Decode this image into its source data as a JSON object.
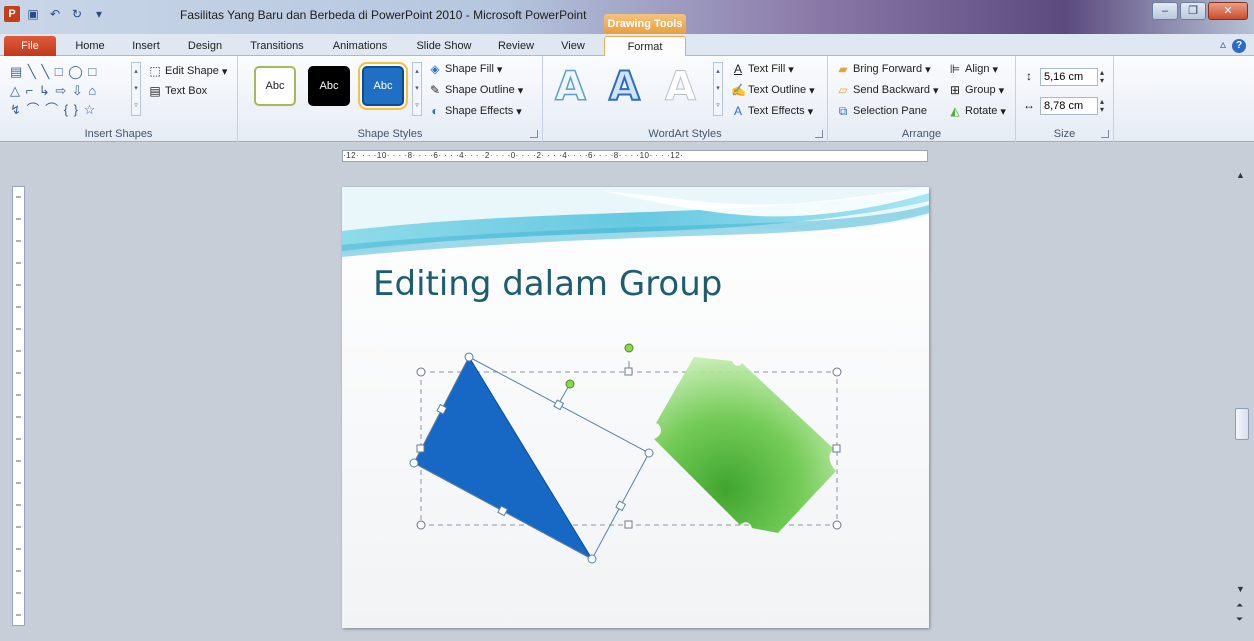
{
  "window": {
    "title": "Fasilitas Yang Baru dan Berbeda di PowerPoint 2010 - Microsoft PowerPoint",
    "contextual_tab_group": "Drawing Tools",
    "app_letter": "P"
  },
  "tabs": [
    {
      "label": "File"
    },
    {
      "label": "Home"
    },
    {
      "label": "Insert"
    },
    {
      "label": "Design"
    },
    {
      "label": "Transitions"
    },
    {
      "label": "Animations"
    },
    {
      "label": "Slide Show"
    },
    {
      "label": "Review"
    },
    {
      "label": "View"
    },
    {
      "label": "Format",
      "active": true
    }
  ],
  "ribbon": {
    "insert_shapes": {
      "label": "Insert Shapes",
      "palette": [
        "▤ ╲ ╲ □ ◯ □",
        "△ ⌐ ↳ ⇨ ⇩ ⌂",
        "↯ ⌒ ⌒ { } ☆"
      ],
      "edit_shape": "Edit Shape",
      "text_box": "Text Box"
    },
    "shape_styles": {
      "label": "Shape Styles",
      "swatch_text": "Abc",
      "shape_fill": "Shape Fill",
      "shape_outline": "Shape Outline",
      "shape_effects": "Shape Effects"
    },
    "wordart_styles": {
      "label": "WordArt Styles",
      "sample": "A",
      "text_fill": "Text Fill",
      "text_outline": "Text Outline",
      "text_effects": "Text Effects"
    },
    "arrange": {
      "label": "Arrange",
      "bring_forward": "Bring Forward",
      "send_backward": "Send Backward",
      "selection_pane": "Selection Pane",
      "align": "Align",
      "group": "Group",
      "rotate": "Rotate"
    },
    "size": {
      "label": "Size",
      "height": "5,16 cm",
      "width": "8,78 cm"
    }
  },
  "ruler": {
    "horizontal": "·12· · · ·10· · · ·8· · · ·6· · · ·4· · · ·2· · · ·0· · · ·2· · · ·4· · · ·6· · · ·8· · · ·10· · · ·12·"
  },
  "slide": {
    "title": "Editing dalam Group"
  },
  "colors": {
    "accent_tab": "#e89f3e",
    "file_tab": "#c0391b",
    "title_text": "#1e5d6e",
    "blue_shape": "#1668c4",
    "green_shape": "#4caf2e"
  }
}
